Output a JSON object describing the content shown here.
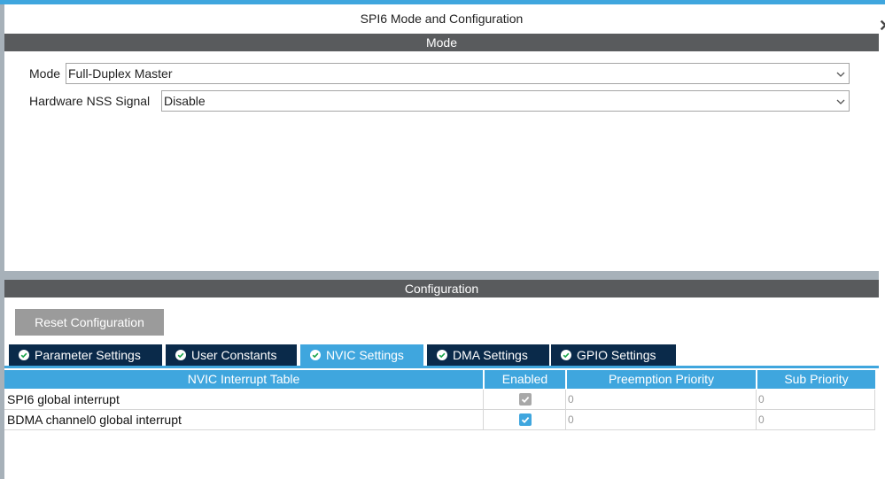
{
  "window": {
    "title": "SPI6 Mode and Configuration"
  },
  "mode": {
    "header": "Mode",
    "fields": [
      {
        "label": "Mode",
        "value": "Full-Duplex Master"
      },
      {
        "label": "Hardware NSS Signal",
        "value": "Disable"
      }
    ]
  },
  "config": {
    "header": "Configuration",
    "reset_label": "Reset Configuration",
    "tabs": [
      {
        "label": "Parameter Settings",
        "active": false
      },
      {
        "label": "User Constants",
        "active": false
      },
      {
        "label": "NVIC Settings",
        "active": true
      },
      {
        "label": "DMA Settings",
        "active": false
      },
      {
        "label": "GPIO Settings",
        "active": false
      }
    ]
  },
  "nvic": {
    "columns": [
      "NVIC Interrupt Table",
      "Enabled",
      "Preemption Priority",
      "Sub Priority"
    ],
    "rows": [
      {
        "name": "SPI6 global interrupt",
        "enabled": true,
        "enabled_locked": true,
        "preemption": "0",
        "sub": "0"
      },
      {
        "name": "BDMA channel0 global interrupt",
        "enabled": true,
        "enabled_locked": false,
        "preemption": "0",
        "sub": "0"
      }
    ]
  },
  "colors": {
    "accent": "#3fa6de",
    "tab_dark": "#0a2a4a",
    "header_grey": "#595b5d",
    "check_ok": "#1aa54a"
  },
  "icons": {
    "tab_status": "check-circle-icon",
    "dropdown": "chevron-down-icon",
    "checkbox": "checkbox-icon"
  }
}
